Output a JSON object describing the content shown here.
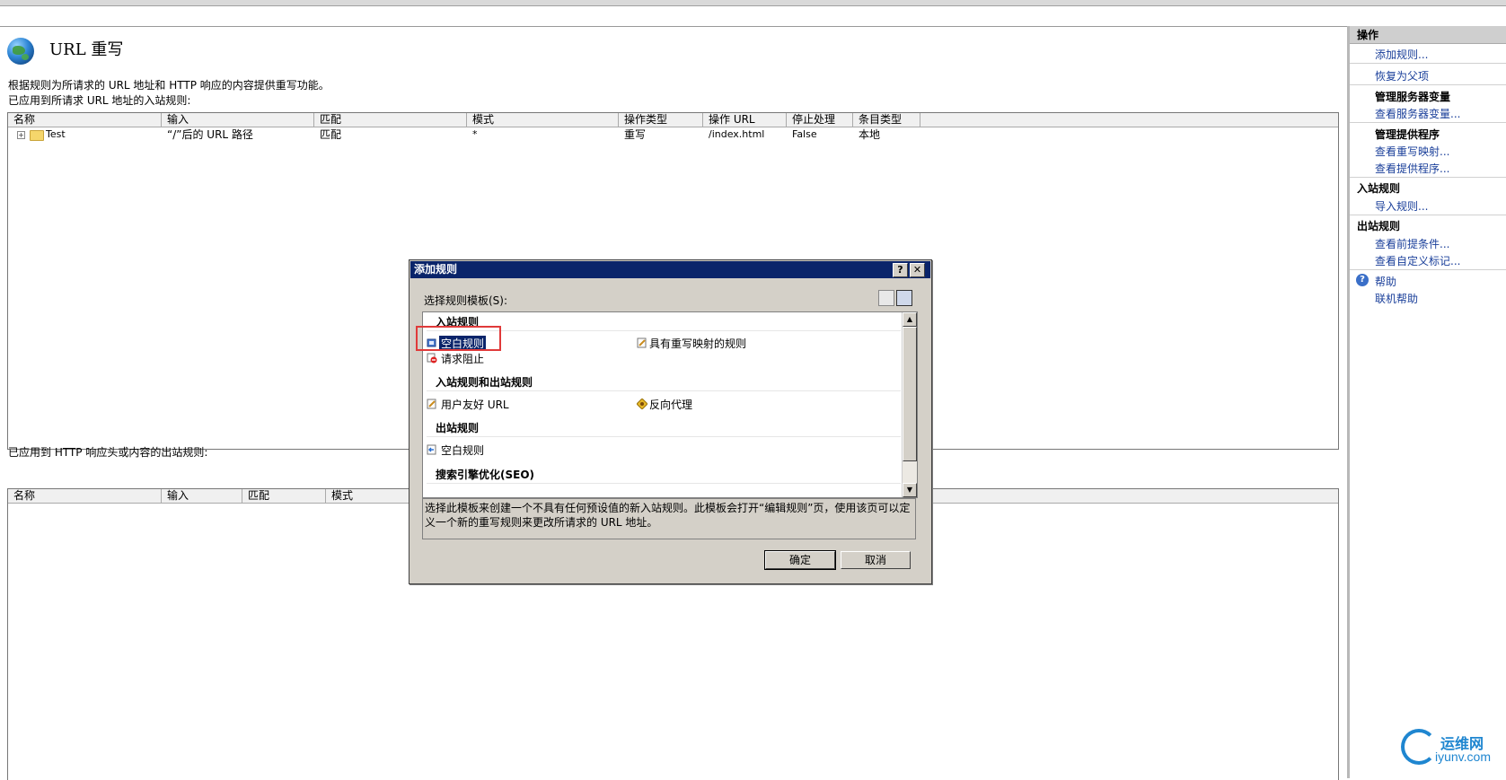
{
  "page": {
    "title": "URL 重写",
    "description": "根据规则为所请求的 URL 地址和 HTTP 响应的内容提供重写功能。",
    "inbound_caption": "已应用到所请求 URL 地址的入站规则:",
    "outbound_caption": "已应用到 HTTP 响应头或内容的出站规则:"
  },
  "inbound_table": {
    "columns": [
      "名称",
      "输入",
      "匹配",
      "模式",
      "操作类型",
      "操作 URL",
      "停止处理",
      "条目类型"
    ],
    "rows": [
      {
        "expand": "+",
        "name": "Test",
        "input": "“/”后的 URL 路径",
        "match": "匹配",
        "pattern": "*",
        "action_type": "重写",
        "action_url": "/index.html",
        "stop": "False",
        "entry_type": "本地"
      }
    ]
  },
  "outbound_table": {
    "columns": [
      "名称",
      "输入",
      "匹配",
      "模式"
    ]
  },
  "sidebar": {
    "header": "操作",
    "add_rule": "添加规则...",
    "revert_parent": "恢复为父项",
    "server_vars_section": "管理服务器变量",
    "view_server_vars": "查看服务器变量...",
    "providers_section": "管理提供程序",
    "view_rewrite_maps": "查看重写映射...",
    "view_providers": "查看提供程序...",
    "inbound_section": "入站规则",
    "import_rules": "导入规则...",
    "outbound_section": "出站规则",
    "view_preconditions": "查看前提条件...",
    "view_custom_tags": "查看自定义标记...",
    "help": "帮助",
    "online_help": "联机帮助"
  },
  "dialog": {
    "title": "添加规则",
    "help_btn": "?",
    "close_btn": "✕",
    "template_label": "选择规则模板(S):",
    "sections": {
      "inbound": "入站规则",
      "inout": "入站规则和出站规则",
      "outbound": "出站规则",
      "seo": "搜索引擎优化(SEO)"
    },
    "items": {
      "blank_rule": "空白规则",
      "map_rule": "具有重写映射的规则",
      "request_block": "请求阻止",
      "friendly_url": "用户友好 URL",
      "reverse_proxy": "反向代理",
      "outbound_blank": "空白规则"
    },
    "info_text": "选择此模板来创建一个不具有任何预设值的新入站规则。此模板会打开“编辑规则”页，使用该页可以定义一个新的重写规则来更改所请求的 URL 地址。",
    "ok": "确定",
    "cancel": "取消"
  },
  "watermark": {
    "cn": "运维网",
    "url": "iyunv.com"
  }
}
